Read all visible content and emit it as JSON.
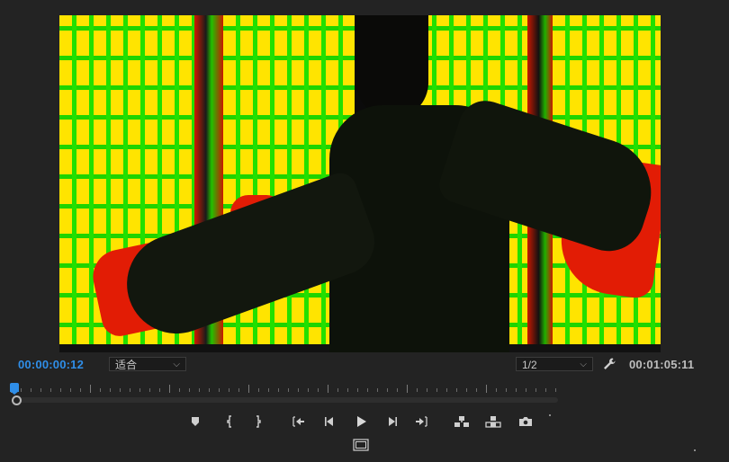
{
  "timecode": {
    "current": "00:00:00:12",
    "duration": "00:01:05:11"
  },
  "fit_select": {
    "value": "适合"
  },
  "resolution_select": {
    "value": "1/2"
  },
  "colors": {
    "accent": "#2f8ee8",
    "background": "#232323",
    "icon": "#cfcfcf"
  },
  "transport": {
    "buttons": [
      "add-marker",
      "mark-in",
      "mark-out",
      "go-to-in",
      "step-back",
      "play",
      "step-forward",
      "go-to-out",
      "insert",
      "overwrite",
      "export-frame",
      "safe-margins"
    ]
  }
}
